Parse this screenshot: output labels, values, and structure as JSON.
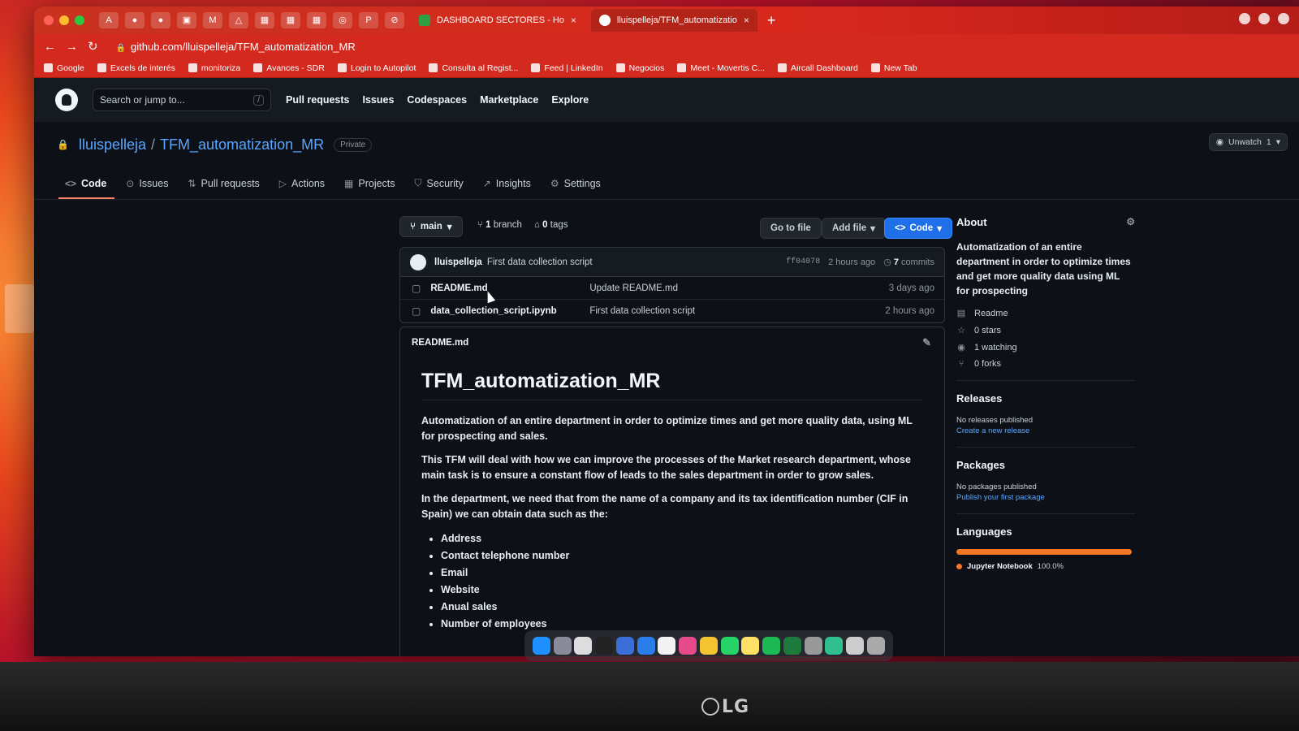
{
  "browser": {
    "pinned_tabs": [
      "A",
      "●",
      "●",
      "▣",
      "M",
      "△",
      "▦",
      "▦",
      "▦",
      "◎",
      "P",
      "⊘"
    ],
    "tabs": [
      {
        "label": "DASHBOARD SECTORES - Ho",
        "close": "×"
      },
      {
        "label": "lluispelleja/TFM_automatizatio",
        "close": "×"
      }
    ],
    "new_tab": "+",
    "url": "github.com/lluispelleja/TFM_automatization_MR",
    "bookmarks": [
      "Google",
      "Excels de interés",
      "monitoriza",
      "Avances - SDR",
      "Login to Autopilot",
      "Consulta al Regist...",
      "Feed | LinkedIn",
      "Negocios",
      "Meet - Movertis C...",
      "Aircall Dashboard",
      "New Tab"
    ]
  },
  "github": {
    "search_placeholder": "Search or jump to...",
    "search_shortcut": "/",
    "nav": [
      "Pull requests",
      "Issues",
      "Codespaces",
      "Marketplace",
      "Explore"
    ]
  },
  "repo": {
    "owner": "lluispelleja",
    "separator": "/",
    "name": "TFM_automatization_MR",
    "visibility": "Private",
    "unwatch_label": "Unwatch",
    "unwatch_count": "1",
    "tabs": [
      "Code",
      "Issues",
      "Pull requests",
      "Actions",
      "Projects",
      "Security",
      "Insights",
      "Settings"
    ],
    "branch": "main",
    "branch_count": "1",
    "branch_label": "branch",
    "tag_count": "0",
    "tag_label": "tags",
    "go_to_file": "Go to file",
    "add_file": "Add file",
    "code_button": "Code",
    "last_commit": {
      "author": "lluispelleja",
      "message": "First data collection script",
      "sha": "ff04078",
      "time": "2 hours ago",
      "commit_count": "7",
      "commit_label": "commits"
    },
    "files": [
      {
        "name": "README.md",
        "message": "Update README.md",
        "age": "3 days ago"
      },
      {
        "name": "data_collection_script.ipynb",
        "message": "First data collection script",
        "age": "2 hours ago"
      }
    ]
  },
  "readme": {
    "file_label": "README.md",
    "title": "TFM_automatization_MR",
    "paragraphs": [
      "Automatization of an entire department in order to optimize times and get more quality data, using ML for prospecting and sales.",
      "This TFM will deal with how we can improve the processes of the Market research department, whose main task is to ensure a constant flow of leads to the sales department in order to grow sales.",
      "In the department, we need that from the name of a company and its tax identification number (CIF in Spain) we can obtain data such as the:"
    ],
    "list": [
      "Address",
      "Contact telephone number",
      "Email",
      "Website",
      "Anual sales",
      "Number of employees"
    ]
  },
  "sidebar": {
    "about_title": "About",
    "about_text": "Automatization of an entire department in order to optimize times and get more quality data using ML for prospecting",
    "readme": "Readme",
    "stars": "0 stars",
    "watching": "1 watching",
    "forks": "0 forks",
    "releases_title": "Releases",
    "releases_none": "No releases published",
    "releases_link": "Create a new release",
    "packages_title": "Packages",
    "packages_none": "No packages published",
    "packages_link": "Publish your first package",
    "languages_title": "Languages",
    "language_name": "Jupyter Notebook",
    "language_percent": "100.0%",
    "language_color": "#f37626"
  },
  "monitor_brand": "LG",
  "colors": {
    "accent_blue": "#58a6ff",
    "primary_button": "#1f6feb",
    "tab_underline": "#f78166",
    "browser_chrome": "#d3291e"
  }
}
